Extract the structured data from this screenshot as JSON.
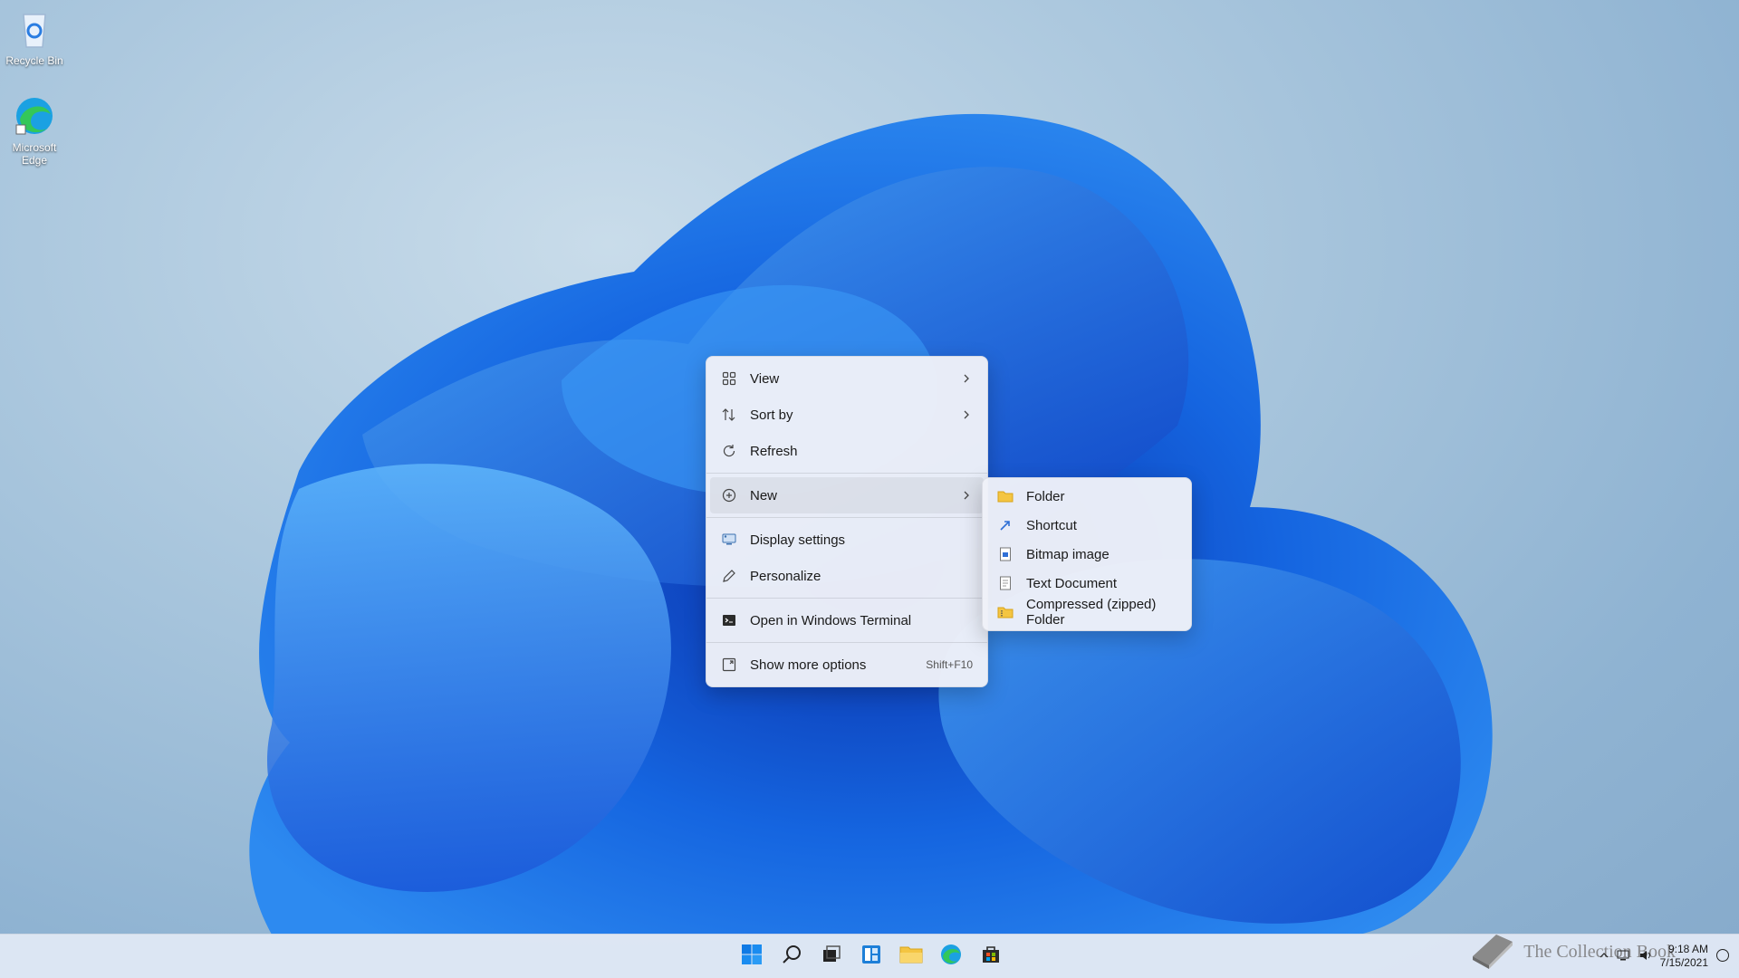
{
  "desktop": {
    "icons": [
      {
        "label": "Recycle Bin",
        "icon": "recycle-bin-icon"
      },
      {
        "label": "Microsoft Edge",
        "icon": "edge-icon"
      }
    ]
  },
  "context_menu": {
    "items": [
      {
        "label": "View",
        "icon": "grid-icon",
        "has_submenu": true
      },
      {
        "label": "Sort by",
        "icon": "sort-icon",
        "has_submenu": true
      },
      {
        "label": "Refresh",
        "icon": "refresh-icon"
      },
      {
        "label": "New",
        "icon": "plus-circle-icon",
        "has_submenu": true,
        "active": true
      },
      {
        "label": "Display settings",
        "icon": "display-icon"
      },
      {
        "label": "Personalize",
        "icon": "pen-icon"
      },
      {
        "label": "Open in Windows Terminal",
        "icon": "terminal-icon"
      },
      {
        "label": "Show more options",
        "icon": "more-options-icon",
        "shortcut": "Shift+F10"
      }
    ]
  },
  "new_submenu": {
    "items": [
      {
        "label": "Folder",
        "icon": "folder-icon"
      },
      {
        "label": "Shortcut",
        "icon": "shortcut-icon"
      },
      {
        "label": "Bitmap image",
        "icon": "bitmap-icon"
      },
      {
        "label": "Text Document",
        "icon": "text-document-icon"
      },
      {
        "label": "Compressed (zipped) Folder",
        "icon": "zip-folder-icon"
      }
    ]
  },
  "taskbar": {
    "apps": [
      "start-icon",
      "search-icon",
      "task-view-icon",
      "widgets-icon",
      "file-explorer-icon",
      "edge-icon",
      "store-icon"
    ],
    "tray": {
      "time": "9:18 AM",
      "date": "7/15/2021"
    }
  },
  "watermark": "The Collection Book",
  "colors": {
    "accent": "#0067c0",
    "folder": "#f4c542"
  }
}
